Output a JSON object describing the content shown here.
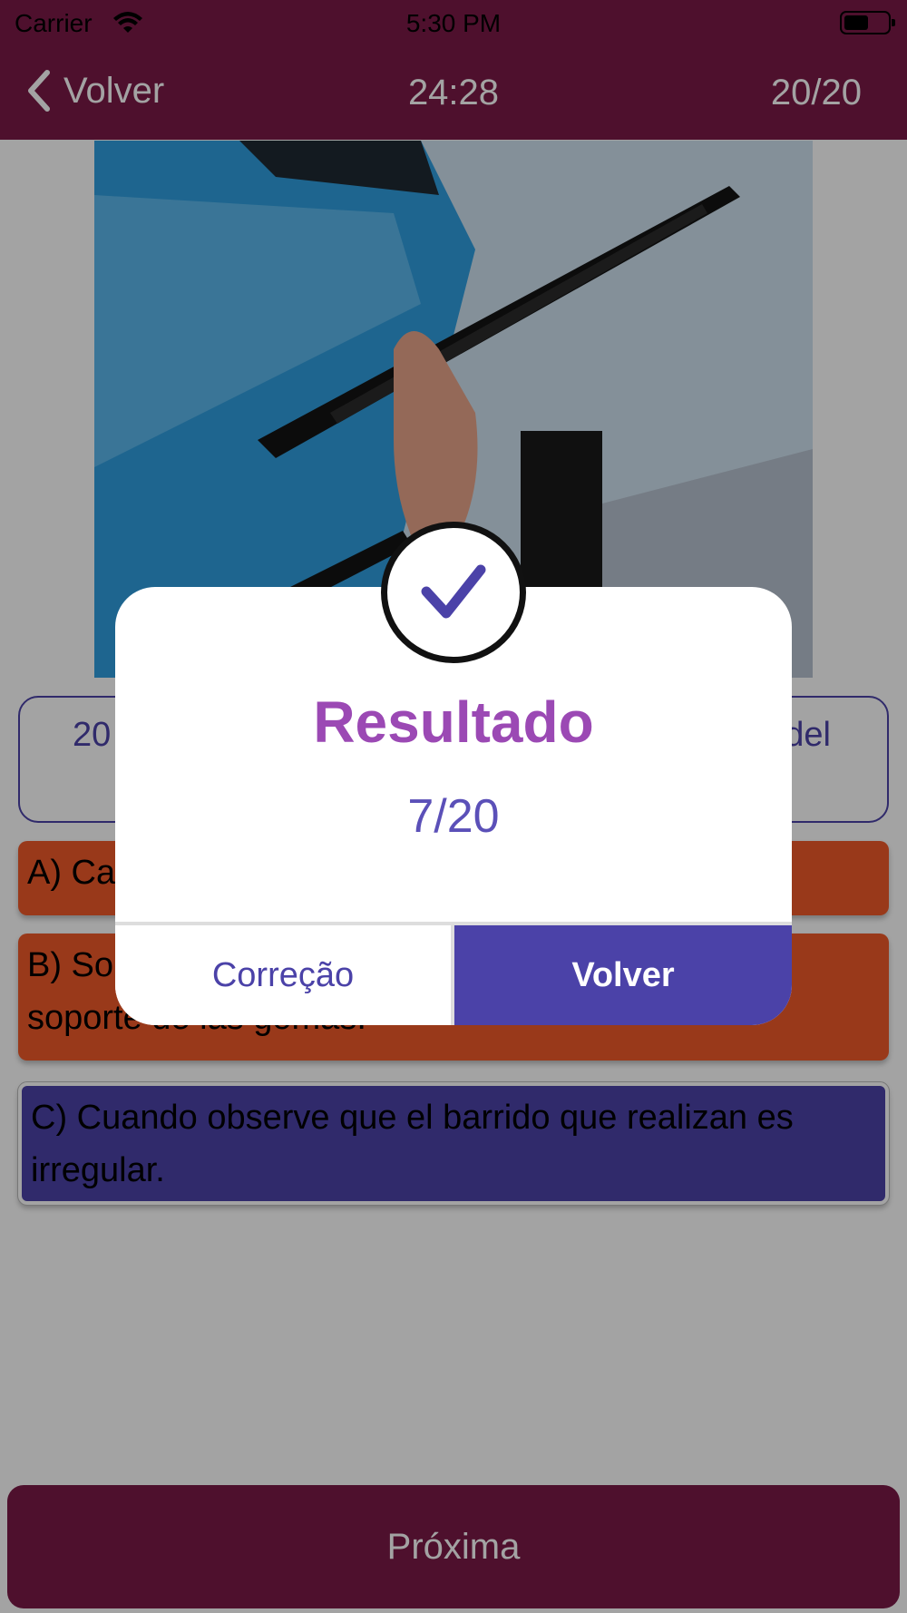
{
  "status_bar": {
    "carrier": "Carrier",
    "time": "5:30 PM"
  },
  "nav": {
    "back_label": "Volver",
    "timer": "24:28",
    "counter": "20/20"
  },
  "question": {
    "visible_left": "20",
    "visible_right": "del"
  },
  "answers": [
    {
      "label": "A) Ca",
      "color": "#ef5a2a"
    },
    {
      "label": "B) So",
      "label_tail": "soporte de las gomas.",
      "color": "#ef5a2a"
    },
    {
      "label": "C) Cuando observe que el barrido que realizan es irregular.",
      "color": "#4b42a8"
    }
  ],
  "next_button": "Próxima",
  "modal": {
    "title": "Resultado",
    "score": "7/20",
    "left_button": "Correção",
    "right_button": "Volver"
  },
  "colors": {
    "brand": "#7a1a47",
    "accent": "#4b42a8",
    "title_purple": "#9b49b4",
    "wrong": "#ef5a2a"
  }
}
